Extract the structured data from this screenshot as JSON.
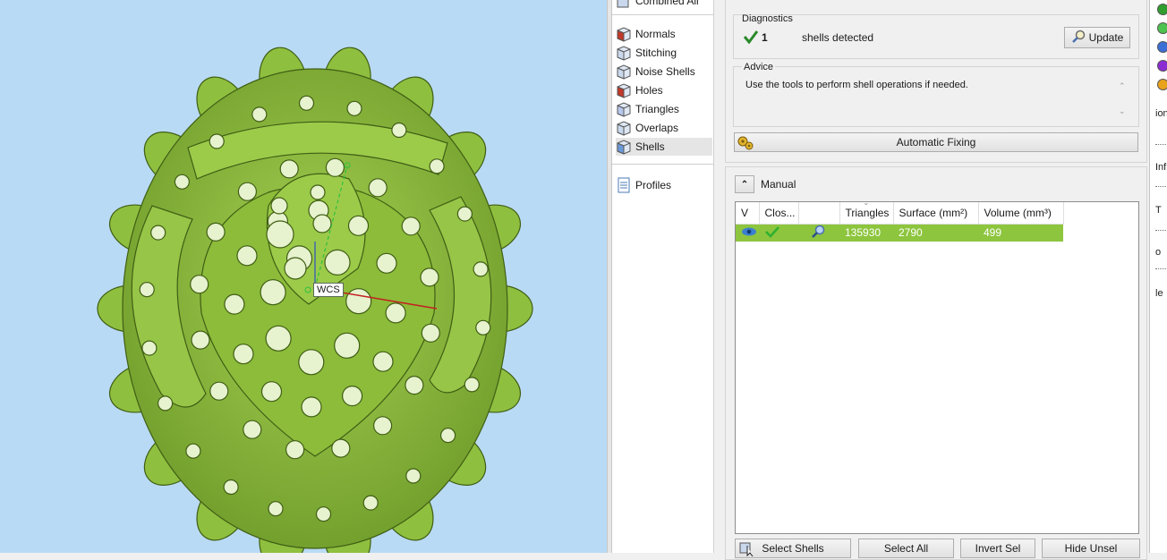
{
  "viewport": {
    "wcs_label": "WCS",
    "background": "#b9daf4",
    "model_color": "#8fbf3f"
  },
  "nav": {
    "top_item": "Combined All",
    "items": [
      {
        "label": "Normals",
        "icon": "normals-cube-icon"
      },
      {
        "label": "Stitching",
        "icon": "stitching-cube-icon"
      },
      {
        "label": "Noise Shells",
        "icon": "noise-shells-cube-icon"
      },
      {
        "label": "Holes",
        "icon": "holes-cube-icon"
      },
      {
        "label": "Triangles",
        "icon": "triangles-cube-icon"
      },
      {
        "label": "Overlaps",
        "icon": "overlaps-cube-icon"
      },
      {
        "label": "Shells",
        "icon": "shells-cube-icon",
        "selected": true
      }
    ],
    "profiles": "Profiles"
  },
  "diagnostics": {
    "title": "Diagnostics",
    "count": "1",
    "text": "shells detected",
    "update_label": "Update"
  },
  "advice": {
    "title": "Advice",
    "text": "Use the tools to perform shell operations if needed."
  },
  "auto_fix_label": "Automatic Fixing",
  "manual": {
    "title": "Manual",
    "columns": [
      "V",
      "Clos...",
      "",
      "Triangles",
      "Surface (mm²)",
      "Volume (mm³)"
    ],
    "rows": [
      {
        "triangles": "135930",
        "surface": "2790",
        "volume": "499"
      }
    ],
    "buttons": {
      "select_shells": "Select Shells",
      "select_all": "Select All",
      "invert_sel": "Invert Sel",
      "hide_unsel": "Hide Unsel"
    }
  },
  "edge": {
    "dots": [
      "#2f9e2f",
      "#4ec24e",
      "#3b6fd6",
      "#8b2bd1",
      "#e8a21c"
    ],
    "texts": [
      "ion",
      "Inf",
      "T",
      "o",
      "le"
    ]
  }
}
